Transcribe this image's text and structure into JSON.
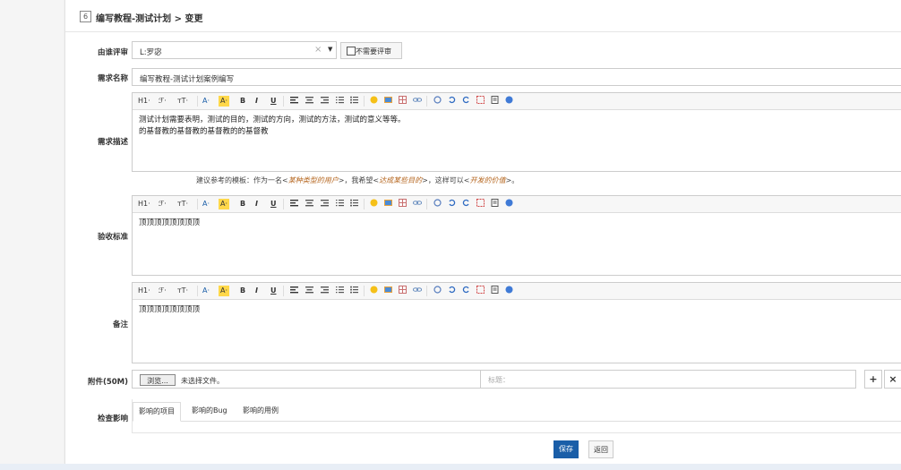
{
  "header": {
    "id": "6",
    "title": "编写教程-测试计划 > 变更"
  },
  "form": {
    "reviewer": {
      "label": "由谁评审",
      "value": "L:罗宓",
      "clear": "×",
      "caret": "▼",
      "no_review_label": "不需要评审"
    },
    "name": {
      "label": "需求名称",
      "value": "编写教程-测试计划案例编写"
    },
    "description": {
      "label": "需求描述",
      "lines": [
        "测试计划需要表明，测试的目的，测试的方向，测试的方法，测试的意义等等。",
        "的基督教的基督教的基督教的的基督教"
      ]
    },
    "hint": {
      "prefix": "建议参考的模板：作为一名<",
      "role": "某种类型的用户",
      "mid1": ">，我希望<",
      "goal": "达成某些目的",
      "mid2": ">，这样可以<",
      "value": "开发的价值",
      "suffix": ">。"
    },
    "acceptance": {
      "label": "验收标准",
      "content": "顶顶顶顶顶顶顶顶"
    },
    "notes": {
      "label": "备注",
      "content": "顶顶顶顶顶顶顶顶"
    },
    "attachment": {
      "label": "附件(50M)",
      "browse": "浏览...",
      "status": "未选择文件。",
      "title_placeholder": "标题：",
      "add": "+",
      "remove": "×"
    },
    "impact": {
      "label": "检查影响",
      "tabs": [
        "影响的项目",
        "影响的Bug",
        "影响的用例"
      ]
    }
  },
  "toolbar": {
    "h1": "H1·",
    "font": "ℱ·",
    "size": "тT·",
    "color": "A·",
    "bg": "A·",
    "bold": "B",
    "italic": "I",
    "underline": "U"
  },
  "actions": {
    "save": "保存",
    "back": "返回"
  }
}
